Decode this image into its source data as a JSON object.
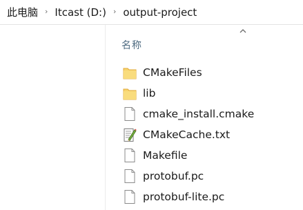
{
  "breadcrumb": {
    "items": [
      "此电脑",
      "Itcast (D:)",
      "output-project"
    ],
    "separator": "›"
  },
  "header": {
    "name_column": "名称"
  },
  "files": [
    {
      "name": "CMakeFiles",
      "icon": "folder-icon"
    },
    {
      "name": "lib",
      "icon": "folder-icon"
    },
    {
      "name": "cmake_install.cmake",
      "icon": "file-icon"
    },
    {
      "name": "CMakeCache.txt",
      "icon": "text-document-icon"
    },
    {
      "name": "Makefile",
      "icon": "file-icon"
    },
    {
      "name": "protobuf.pc",
      "icon": "file-icon"
    },
    {
      "name": "protobuf-lite.pc",
      "icon": "file-icon"
    }
  ],
  "colors": {
    "folder": "#f7d36c",
    "folder_dark": "#e0a93a",
    "header_text": "#4d6a80"
  }
}
